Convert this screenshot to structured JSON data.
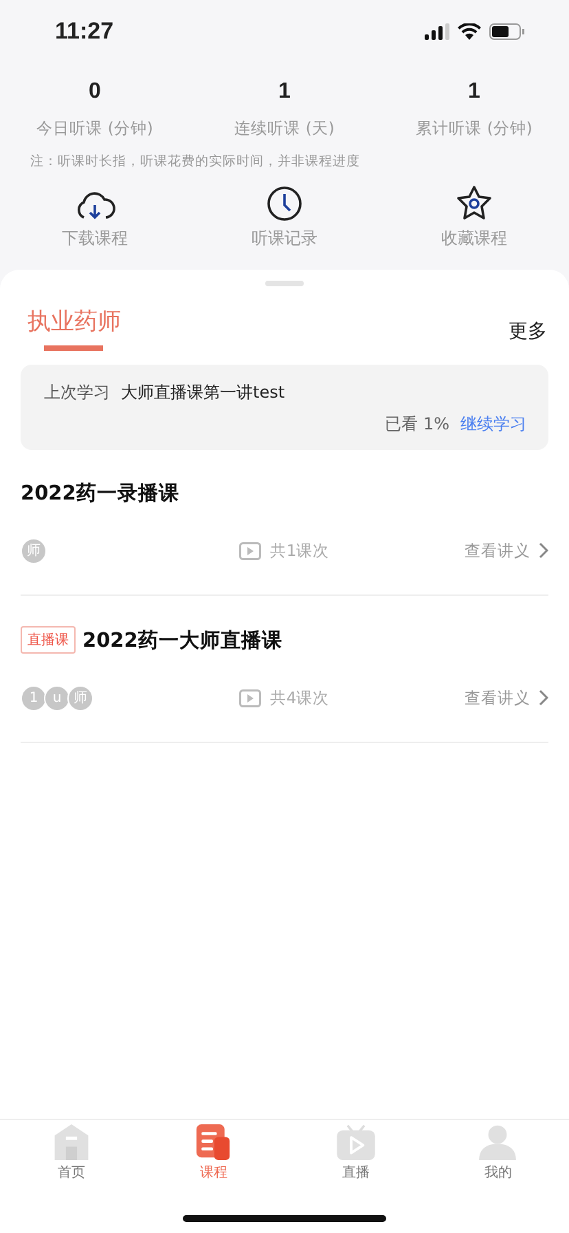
{
  "status_bar": {
    "time": "11:27"
  },
  "stats": [
    {
      "value": "0",
      "label": "今日听课 (分钟)"
    },
    {
      "value": "1",
      "label": "连续听课 (天)"
    },
    {
      "value": "1",
      "label": "累计听课 (分钟)"
    }
  ],
  "note": "注：听课时长指，听课花费的实际时间，并非课程进度",
  "shortcuts": [
    {
      "kind": "download",
      "label": "下载课程"
    },
    {
      "kind": "history",
      "label": "听课记录"
    },
    {
      "kind": "favorite",
      "label": "收藏课程"
    }
  ],
  "section": {
    "tab": "执业药师",
    "more": "更多"
  },
  "last_study": {
    "label": "上次学习",
    "title": "大师直播课第一讲test",
    "progress": "已看 1%",
    "action": "继续学习"
  },
  "courses": [
    {
      "title": "2022药一录播课",
      "avatars": [
        "师"
      ],
      "count": "共1课次",
      "handout": "查看讲义"
    },
    {
      "tag": "直播课",
      "title": "2022药一大师直播课",
      "avatars": [
        "1",
        "u",
        "师"
      ],
      "count": "共4课次",
      "handout": "查看讲义"
    }
  ],
  "tab_bar": [
    {
      "kind": "home",
      "label": "首页",
      "selected": false
    },
    {
      "kind": "course",
      "label": "课程",
      "selected": true
    },
    {
      "kind": "live",
      "label": "直播",
      "selected": false
    },
    {
      "kind": "me",
      "label": "我的",
      "selected": false
    }
  ]
}
